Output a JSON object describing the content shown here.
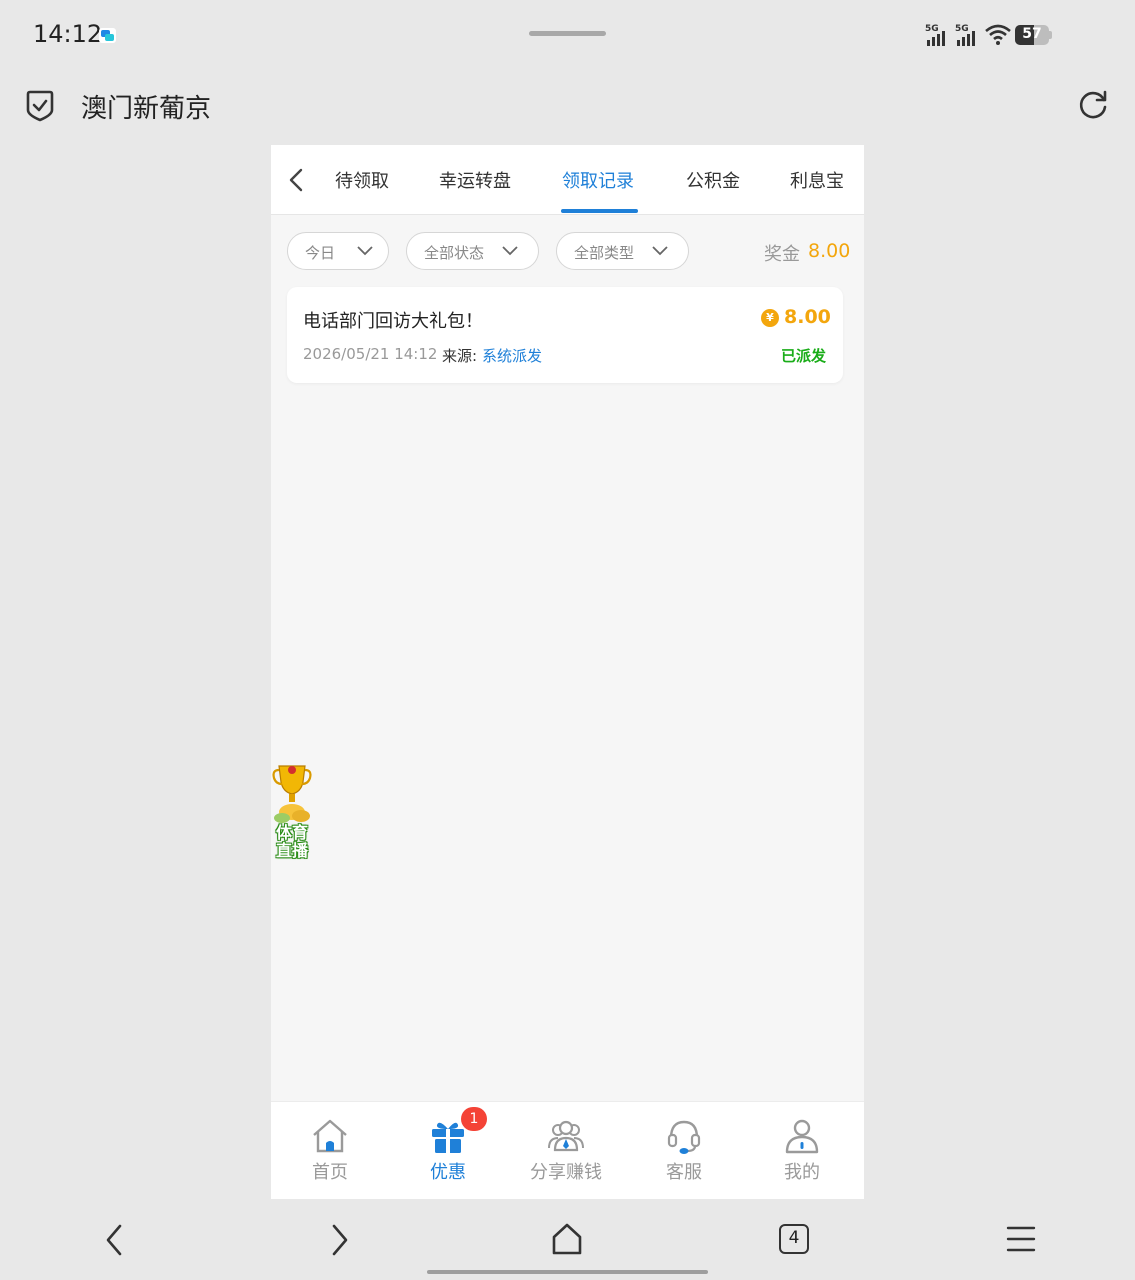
{
  "status_bar": {
    "time": "14:12",
    "signal_1": "5G",
    "signal_2": "5G",
    "battery": "57"
  },
  "browser": {
    "site_title": "澳门新葡京"
  },
  "tabs": {
    "items": [
      "待领取",
      "幸运转盘",
      "领取记录",
      "公积金",
      "利息宝"
    ],
    "active": "领取记录"
  },
  "filters": {
    "date": "今日",
    "status": "全部状态",
    "type": "全部类型",
    "bonus_label": "奖金",
    "bonus_value": "8.00"
  },
  "records": [
    {
      "title": "电话部门回访大礼包！",
      "amount": "8.00",
      "coin_symbol": "¥",
      "date": "2026/05/21 14:12",
      "source_label": "来源:",
      "source_value": "系统派发",
      "status": "已派发"
    }
  ],
  "floating_badge": {
    "label": "体育直播"
  },
  "bottom_nav": {
    "items": [
      {
        "label": "首页",
        "icon": "home-icon"
      },
      {
        "label": "优惠",
        "icon": "gift-icon",
        "badge": "1"
      },
      {
        "label": "分享赚钱",
        "icon": "share-people-icon"
      },
      {
        "label": "客服",
        "icon": "headset-icon"
      },
      {
        "label": "我的",
        "icon": "user-icon"
      }
    ],
    "active": "优惠"
  },
  "system_nav": {
    "tab_count": "4"
  },
  "colors": {
    "accent": "#1f80d8",
    "gold": "#f3a60d",
    "success": "#1aad19",
    "badge": "#f44336"
  }
}
